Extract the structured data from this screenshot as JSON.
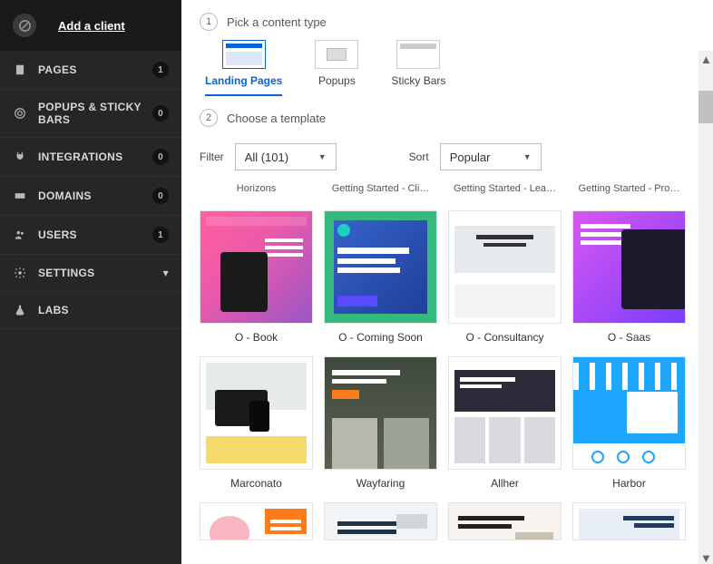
{
  "header": {
    "add_client": "Add a client"
  },
  "nav": {
    "pages": {
      "label": "PAGES",
      "badge": "1"
    },
    "popups": {
      "label": "POPUPS & STICKY BARS",
      "badge": "0"
    },
    "integrations": {
      "label": "INTEGRATIONS",
      "badge": "0"
    },
    "domains": {
      "label": "DOMAINS",
      "badge": "0"
    },
    "users": {
      "label": "USERS",
      "badge": "1"
    },
    "settings": {
      "label": "SETTINGS"
    },
    "labs": {
      "label": "LABS"
    }
  },
  "steps": {
    "one_num": "1",
    "one_label": "Pick a content type",
    "two_num": "2",
    "two_label": "Choose a template"
  },
  "content_types": {
    "landing": "Landing Pages",
    "popups": "Popups",
    "sticky": "Sticky Bars"
  },
  "filter": {
    "label": "Filter",
    "value": "All (101)",
    "sort_label": "Sort",
    "sort_value": "Popular"
  },
  "top_labels": {
    "a": "Horizons",
    "b": "Getting Started - Cli…",
    "c": "Getting Started - Lea…",
    "d": "Getting Started - Pro…"
  },
  "templates": {
    "r1": {
      "a": "O - Book",
      "b": "O - Coming Soon",
      "c": "O - Consultancy",
      "d": "O - Saas"
    },
    "r2": {
      "a": "Marconato",
      "b": "Wayfaring",
      "c": "Allher",
      "d": "Harbor"
    }
  }
}
